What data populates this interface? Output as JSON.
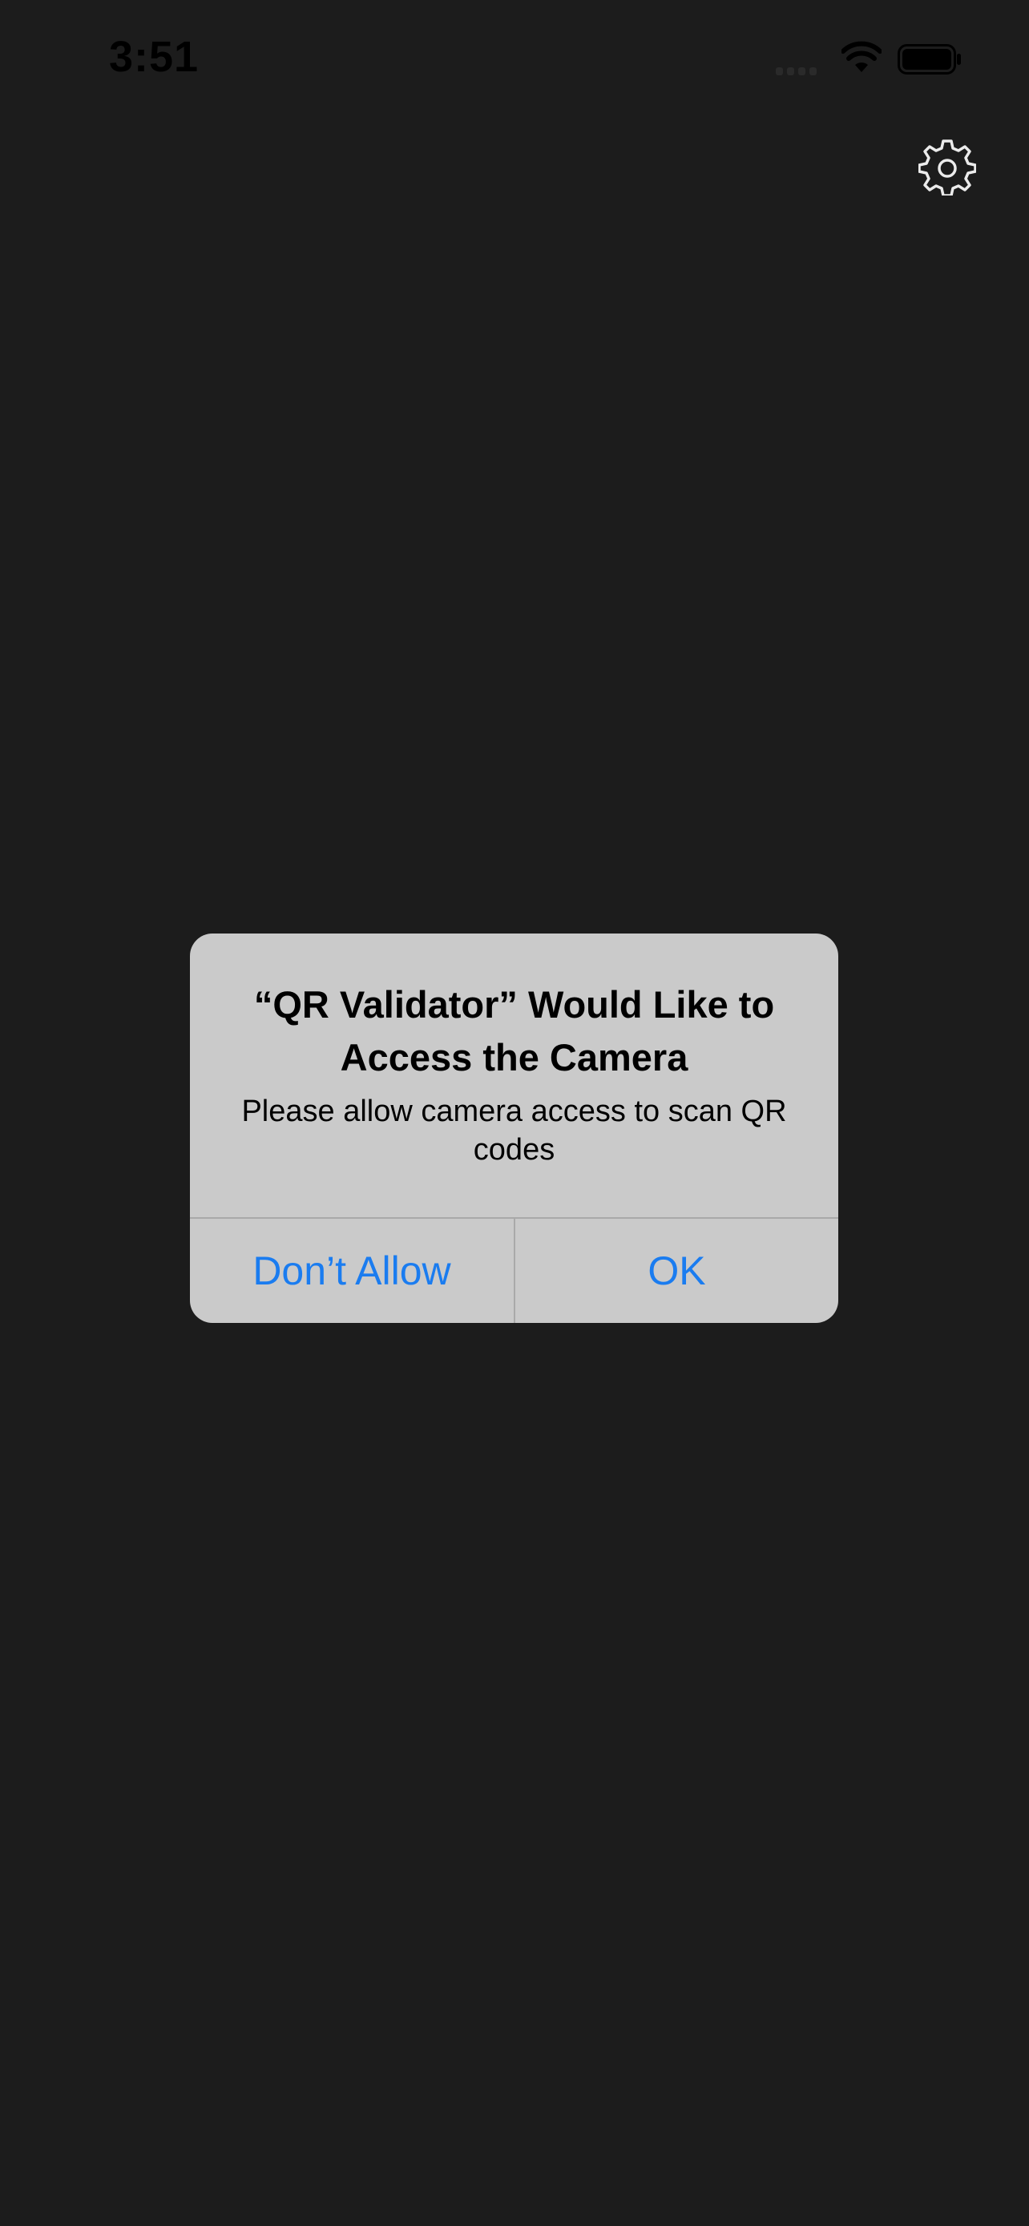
{
  "status_bar": {
    "time": "3:51",
    "signal_icon": "cellular-signal-icon",
    "wifi_icon": "wifi-icon",
    "battery_icon": "battery-icon"
  },
  "toolbar": {
    "settings_icon": "gear-icon"
  },
  "alert": {
    "title": "“QR Validator” Would Like to Access the Camera",
    "message": "Please allow camera access to scan QR codes",
    "buttons": [
      {
        "label": "Don’t Allow"
      },
      {
        "label": "OK"
      }
    ]
  },
  "colors": {
    "background": "#1c1c1c",
    "alert_background": "#cacaca",
    "button_text": "#1a7cf0"
  }
}
